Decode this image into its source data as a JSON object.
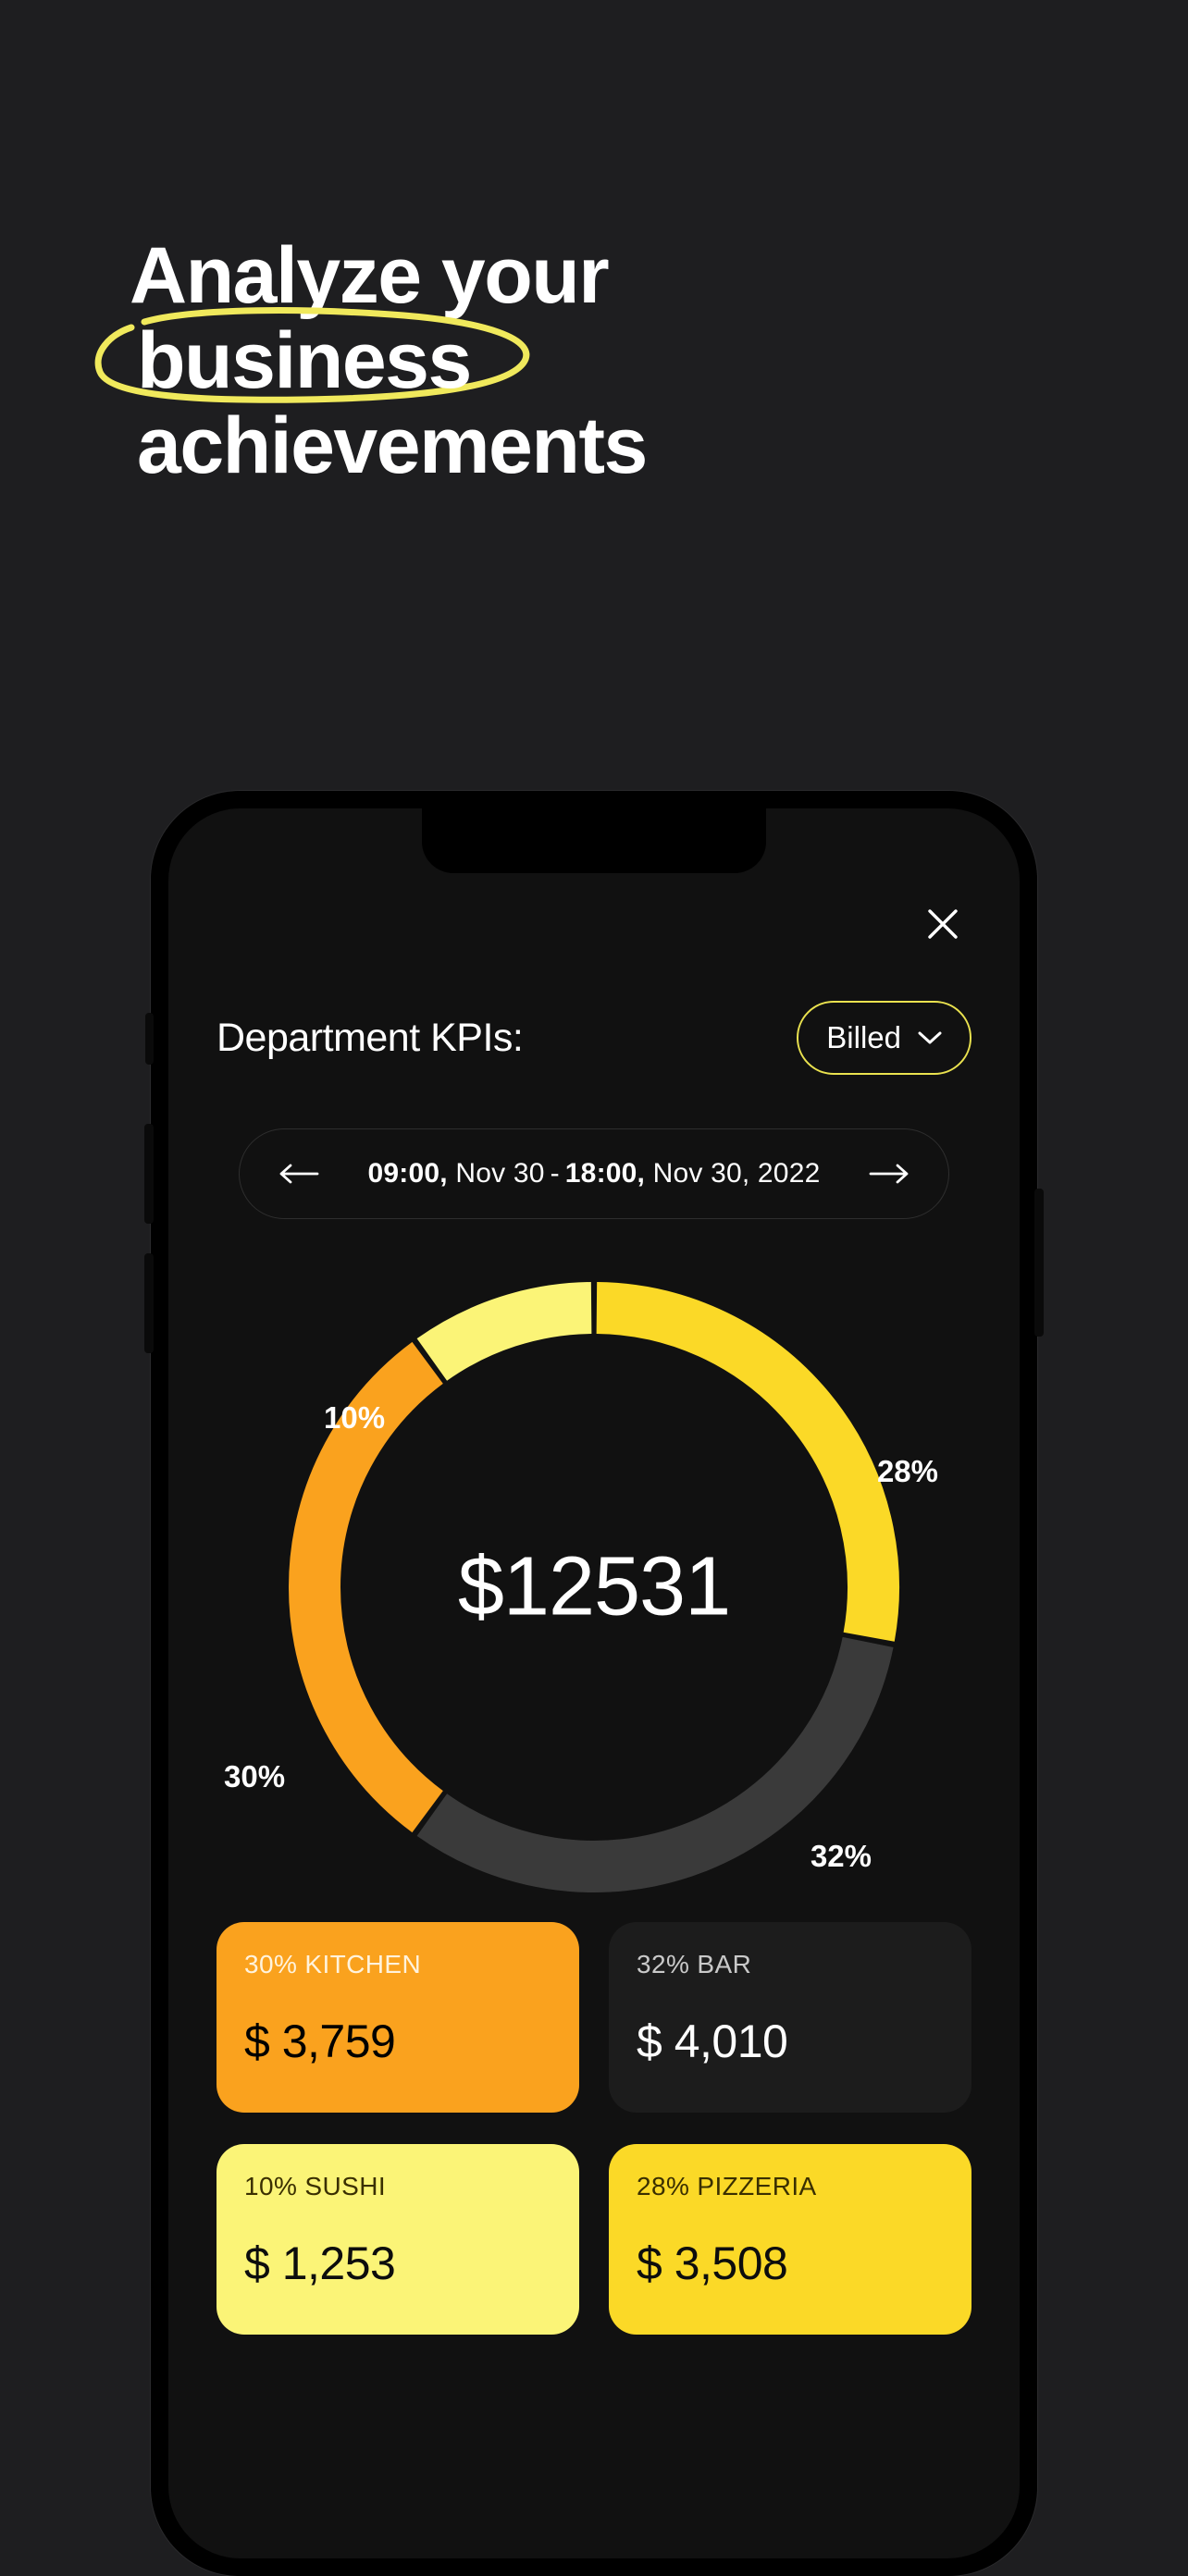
{
  "page": {
    "background": "#1e1e20",
    "headline_lines": [
      "Analyze your",
      "business",
      "achievements"
    ],
    "headline_highlight_word": "business",
    "highlight_color": "#f0e95c"
  },
  "app": {
    "close_icon": "close-icon",
    "title": "Department KPIs:",
    "filter": {
      "label": "Billed",
      "chevron_icon": "chevron-down-icon",
      "border_color": "#eae24f"
    },
    "date_range": {
      "prev_icon": "arrow-left-icon",
      "next_icon": "arrow-right-icon",
      "start_time": "09:00,",
      "start_date": " Nov 30",
      "separator": "-",
      "end_time": "18:00,",
      "end_date": " Nov 30, 2022"
    },
    "donut_center_value": "$12531",
    "cards": [
      {
        "head": "30% KITCHEN",
        "value": "$ 3,759",
        "style": "orange",
        "color": "#faa21e"
      },
      {
        "head": "32% BAR",
        "value": "$ 4,010",
        "style": "dark",
        "color": "#1c1c1c"
      },
      {
        "head": "10% SUSHI",
        "value": "$ 1,253",
        "style": "light",
        "color": "#fbf477"
      },
      {
        "head": "28% PIZZERIA",
        "value": "$ 3,508",
        "style": "light",
        "color": "#fbd927"
      }
    ]
  },
  "chart_data": {
    "type": "pie",
    "title": "Department KPIs",
    "center_label": "$12531",
    "categories": [
      "Pizzeria",
      "Bar",
      "Kitchen",
      "Sushi"
    ],
    "values": [
      28,
      32,
      30,
      10
    ],
    "amounts": [
      3508,
      4010,
      3759,
      1253
    ],
    "colors": [
      "#fbd927",
      "#3a3a3a",
      "#faa21e",
      "#fbf477"
    ],
    "labels": [
      "28%",
      "32%",
      "30%",
      "10%"
    ],
    "unit": "%",
    "total": 12531,
    "currency": "$",
    "legend": "cards-below",
    "start_angle_deg": 0,
    "direction": "clockwise",
    "inner_radius_ratio": 0.78
  }
}
